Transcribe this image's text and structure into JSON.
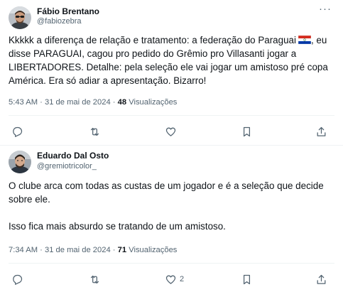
{
  "tweets": [
    {
      "author_name": "Fábio Brentano",
      "author_handle": "@fabiozebra",
      "text": "Kkkkk a diferença de relação e tratamento: a federação do Paraguai",
      "text_emoji": "paraguay-flag",
      "text_rest": ", eu disse PARAGUAI, cagou pro pedido do Grêmio pro Villasanti jogar a LIBERTADORES. Detalhe: pela seleção ele vai jogar um amistoso pré copa América. Era só adiar a apresentação. Bizarro!",
      "time": "5:43 AM",
      "date": "31 de mai de 2024",
      "views_count": "48",
      "views_label": "Visualizações",
      "reply_count": "",
      "retweet_count": "",
      "like_count": ""
    },
    {
      "author_name": "Eduardo Dal Osto",
      "author_handle": "@gremiotricolor_",
      "paragraph1": "O clube arca com todas as custas de um jogador e é a seleção que decide sobre ele.",
      "paragraph2": "Isso fica mais absurdo se tratando de um amistoso.",
      "time": "7:34 AM",
      "date": "31 de mai de 2024",
      "views_count": "71",
      "views_label": "Visualizações",
      "reply_count": "",
      "retweet_count": "",
      "like_count": "2"
    }
  ],
  "more_glyph": "···",
  "dot": "·",
  "icons": [
    "reply-icon",
    "retweet-icon",
    "like-icon",
    "bookmark-icon",
    "share-icon",
    "more-icon"
  ],
  "colors": {
    "text": "#0f1419",
    "secondary": "#536471",
    "divider": "#eff3f4"
  }
}
